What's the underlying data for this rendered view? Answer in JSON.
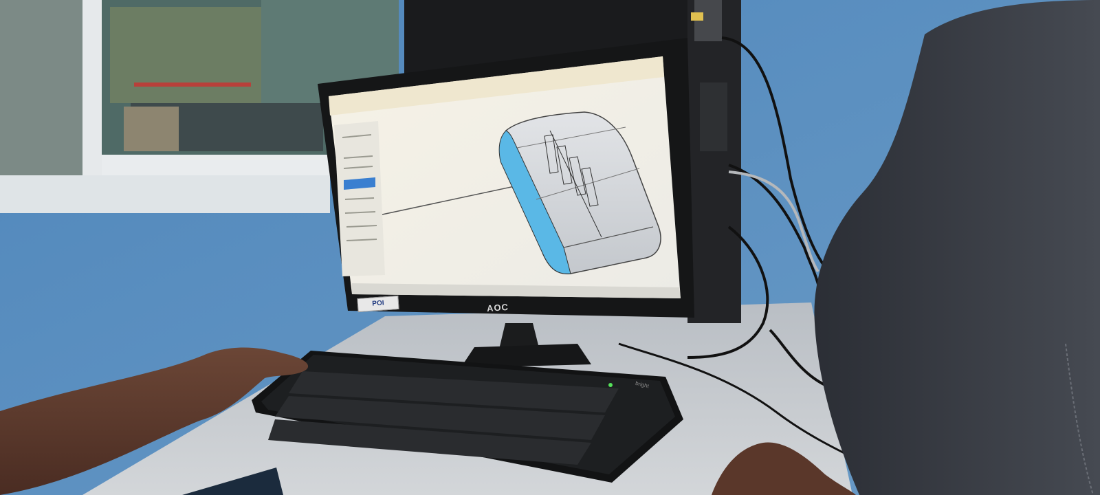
{
  "monitor": {
    "brand": "AOC",
    "sticker": "POI"
  },
  "keyboard": {
    "brand": "bright"
  },
  "colors": {
    "wall": "#5b8fbf",
    "monitor_bezel": "#151617",
    "cad_part_face": "#c9cdd2",
    "cad_part_end": "#5ab8e6",
    "desk": "#c8ccd0",
    "jacket": "#3a3d44"
  }
}
